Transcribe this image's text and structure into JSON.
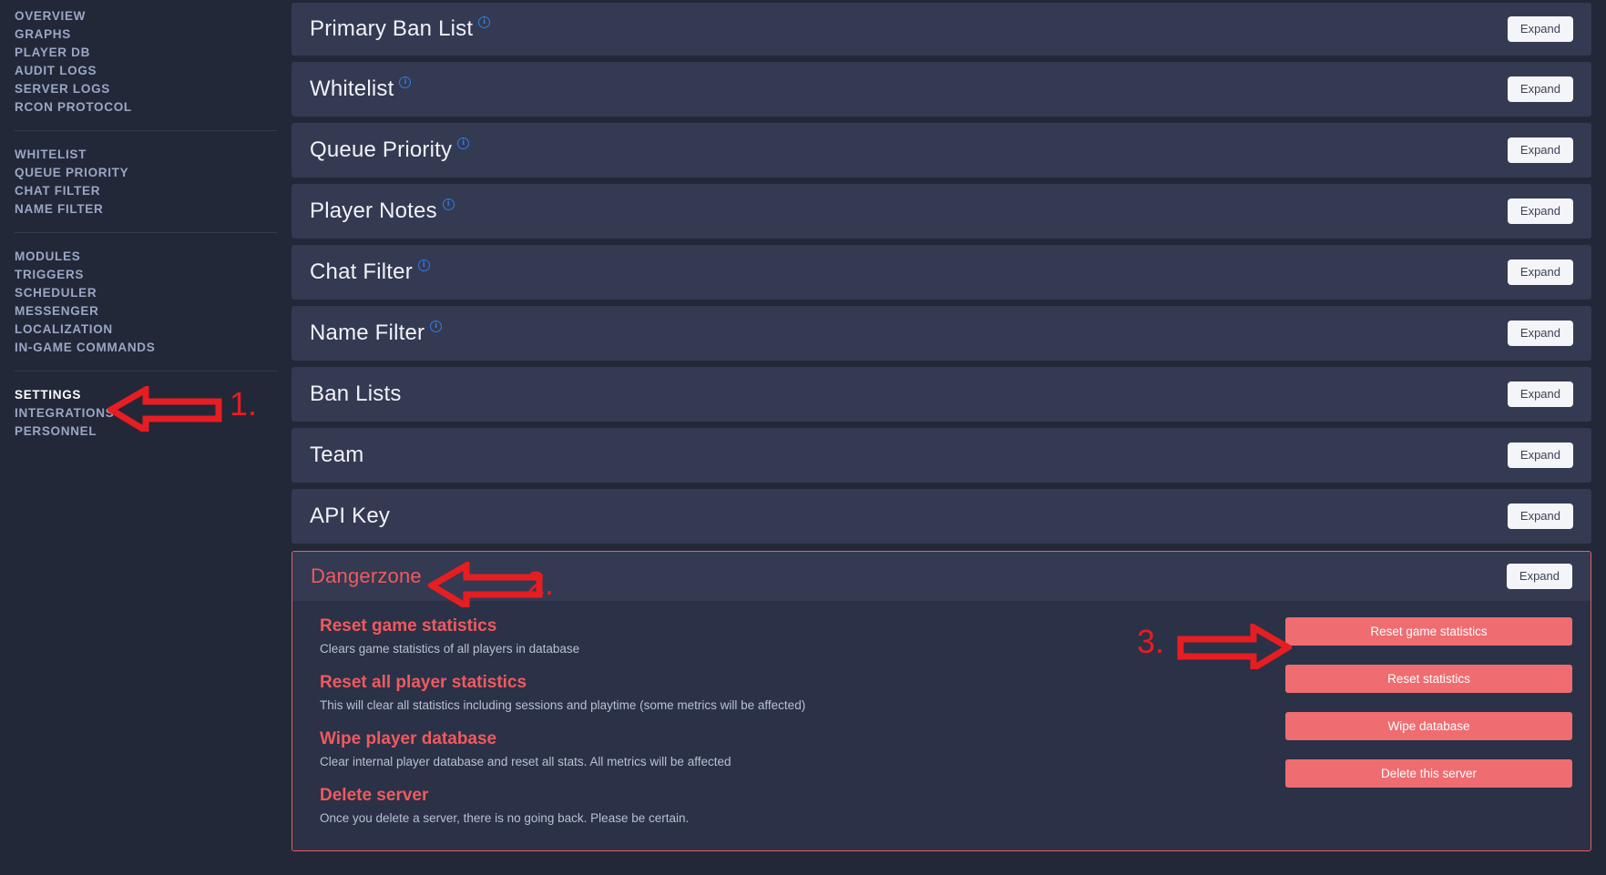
{
  "sidebar": {
    "groups": [
      {
        "items": [
          {
            "label": "OVERVIEW",
            "active": false
          },
          {
            "label": "GRAPHS",
            "active": false
          },
          {
            "label": "PLAYER DB",
            "active": false
          },
          {
            "label": "AUDIT LOGS",
            "active": false
          },
          {
            "label": "SERVER LOGS",
            "active": false
          },
          {
            "label": "RCON PROTOCOL",
            "active": false
          }
        ]
      },
      {
        "items": [
          {
            "label": "WHITELIST",
            "active": false
          },
          {
            "label": "QUEUE PRIORITY",
            "active": false
          },
          {
            "label": "CHAT FILTER",
            "active": false
          },
          {
            "label": "NAME FILTER",
            "active": false
          }
        ]
      },
      {
        "items": [
          {
            "label": "MODULES",
            "active": false
          },
          {
            "label": "TRIGGERS",
            "active": false
          },
          {
            "label": "SCHEDULER",
            "active": false
          },
          {
            "label": "MESSENGER",
            "active": false
          },
          {
            "label": "LOCALIZATION",
            "active": false
          },
          {
            "label": "IN-GAME COMMANDS",
            "active": false
          }
        ]
      },
      {
        "items": [
          {
            "label": "SETTINGS",
            "active": true
          },
          {
            "label": "INTEGRATIONS",
            "active": false
          },
          {
            "label": "PERSONNEL",
            "active": false
          }
        ]
      }
    ]
  },
  "main": {
    "expand_label": "Expand",
    "info_glyph": "i",
    "cards": [
      {
        "title": "Primary Ban List",
        "has_info": true
      },
      {
        "title": "Whitelist",
        "has_info": true
      },
      {
        "title": "Queue Priority",
        "has_info": true
      },
      {
        "title": "Player Notes",
        "has_info": true
      },
      {
        "title": "Chat Filter",
        "has_info": true
      },
      {
        "title": "Name Filter",
        "has_info": true
      },
      {
        "title": "Ban Lists",
        "has_info": false
      },
      {
        "title": "Team",
        "has_info": false
      },
      {
        "title": "API Key",
        "has_info": false
      }
    ],
    "dangerzone": {
      "title": "Dangerzone",
      "expand_label": "Expand",
      "actions": [
        {
          "title": "Reset game statistics",
          "description": "Clears game statistics of all players in database",
          "button": "Reset game statistics"
        },
        {
          "title": "Reset all player statistics",
          "description": "This will clear all statistics including sessions and playtime (some metrics will be affected)",
          "button": "Reset statistics"
        },
        {
          "title": "Wipe player database",
          "description": "Clear internal player database and reset all stats. All metrics will be affected",
          "button": "Wipe database"
        },
        {
          "title": "Delete server",
          "description": "Once you delete a server, there is no going back. Please be certain.",
          "button": "Delete this server"
        }
      ]
    }
  },
  "annotations": {
    "color": "#e71d22",
    "steps": [
      {
        "label": "1.",
        "target": "sidebar-item-settings",
        "direction": "left"
      },
      {
        "label": "2.",
        "target": "dangerzone-title",
        "direction": "left"
      },
      {
        "label": "3.",
        "target": "reset-game-statistics-button",
        "direction": "right"
      }
    ]
  }
}
